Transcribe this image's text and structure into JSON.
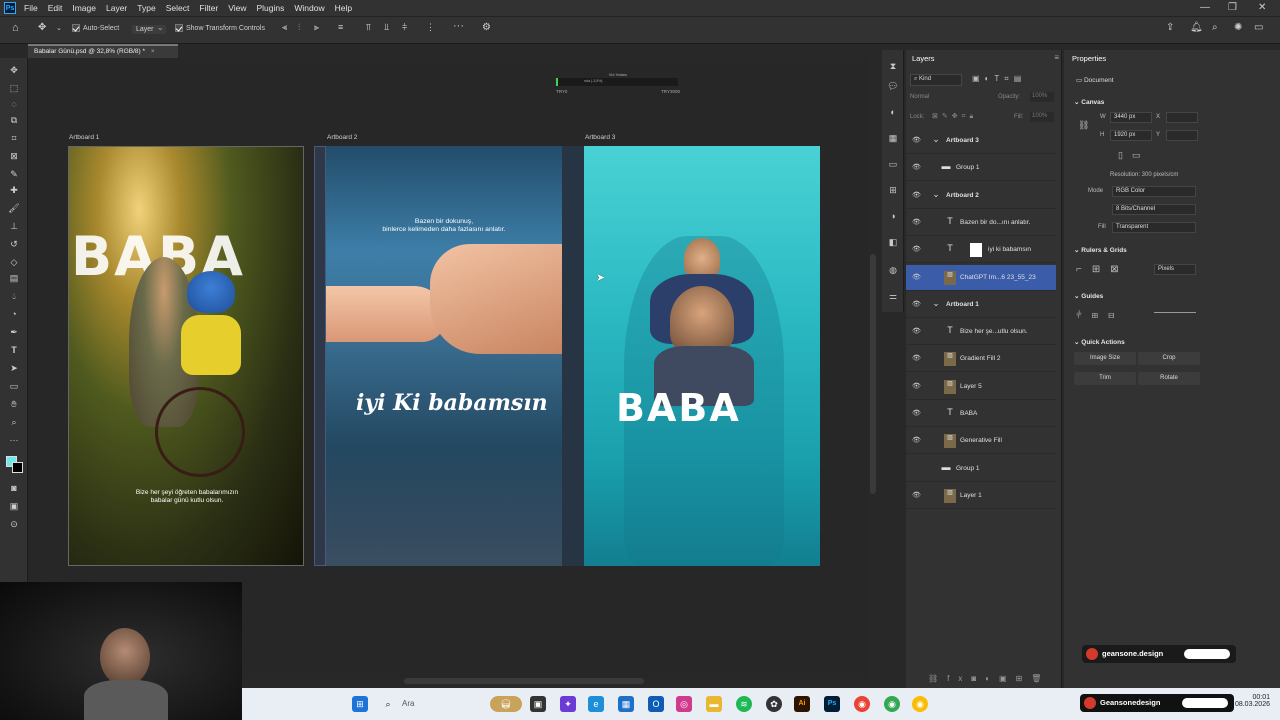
{
  "menu": {
    "logo": "Ps",
    "items": [
      "File",
      "Edit",
      "Image",
      "Layer",
      "Type",
      "Select",
      "Filter",
      "View",
      "Plugins",
      "Window",
      "Help"
    ]
  },
  "options": {
    "auto_select_label": "Auto-Select",
    "auto_select_target": "Layer",
    "show_transform_label": "Show Transform Controls"
  },
  "document": {
    "tab_title": "Babalar Günü.psd @ 32,8% (RGB/8) *"
  },
  "progress": {
    "title": "Vid Hatası",
    "subtitle": "rota (-3,5%)",
    "left_label": "TRY0",
    "right_label": "TRY3000",
    "fraction": 0.02
  },
  "artboards": [
    {
      "label": "Artboard 1",
      "headline": "BABA",
      "slogan_line1": "Bize her şeyi öğreten babalarımızın",
      "slogan_line2": "babalar günü kutlu olsun."
    },
    {
      "label": "Artboard 2",
      "top_line1": "Bazen bir dokunuş,",
      "top_line2": "binlerce kelimeden daha fazlasını anlatır.",
      "script": "iyi Ki babamsın"
    },
    {
      "label": "Artboard 3",
      "headline": "BABA"
    }
  ],
  "layers_panel": {
    "title": "Layers",
    "filter_kind": "Kind",
    "blend_mode": "Normal",
    "opacity_label": "Opacity:",
    "opacity_value": "100%",
    "lock_label": "Lock:",
    "fill_label": "Fill:",
    "fill_value": "100%",
    "rows": [
      {
        "name": "Artboard 3",
        "type": "artboard",
        "indent": 0
      },
      {
        "name": "Group 1",
        "type": "group",
        "indent": 1
      },
      {
        "name": "Artboard 2",
        "type": "artboard",
        "indent": 0
      },
      {
        "name": "Bazen bir do...ını anlatır.",
        "type": "text",
        "indent": 1
      },
      {
        "name": "iyi ki babamsın",
        "type": "text-mask",
        "indent": 1
      },
      {
        "name": "ChatGPT Im...6 23_55_23",
        "type": "image",
        "indent": 1,
        "selected": true
      },
      {
        "name": "Artboard 1",
        "type": "artboard",
        "indent": 0
      },
      {
        "name": "Bize her şe...utlu olsun.",
        "type": "text",
        "indent": 1
      },
      {
        "name": "Gradient Fill 2",
        "type": "image",
        "indent": 1
      },
      {
        "name": "Layer 5",
        "type": "image",
        "indent": 1
      },
      {
        "name": "BABA",
        "type": "text",
        "indent": 1
      },
      {
        "name": "Generative Fill",
        "type": "image",
        "indent": 1
      },
      {
        "name": "Group 1",
        "type": "group",
        "indent": 1
      },
      {
        "name": "Layer 1",
        "type": "image",
        "indent": 1
      }
    ]
  },
  "properties": {
    "title": "Properties",
    "document_label": "Document",
    "canvas_header": "Canvas",
    "w_label": "W",
    "w_value": "3440 px",
    "h_label": "H",
    "h_value": "1920 px",
    "x_label": "X",
    "y_label": "Y",
    "resolution": "Resolution: 300 pixels/cm",
    "mode_label": "Mode",
    "mode_value": "RGB Color",
    "bits_value": "8 Bits/Channel",
    "fill_label": "Fill",
    "fill_value": "Transparent",
    "rulers_header": "Rulers & Grids",
    "units_value": "Pixels",
    "guides_header": "Guides",
    "quick_header": "Quick Actions",
    "btn_image_size": "Image Size",
    "btn_crop": "Crop",
    "btn_trim": "Trim",
    "btn_rotate": "Rotate"
  },
  "taskbar": {
    "search_placeholder": "Ara",
    "time": "00:01",
    "date": "08.03.2026"
  },
  "badges": {
    "top": "geansone.design",
    "bottom": "Geansonedesign"
  },
  "colors": {
    "selection": "#3b5ca8",
    "accent_progress": "#3ad65a",
    "artboard3_bg": "#2bb9c2"
  }
}
